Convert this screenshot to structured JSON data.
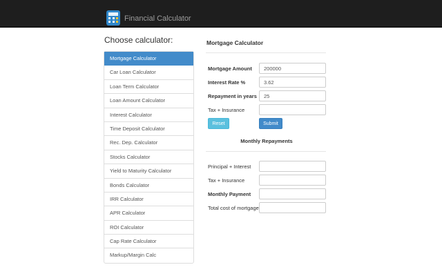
{
  "header": {
    "app_title": "Financial Calculator",
    "icon": "calculator-icon"
  },
  "sidebar": {
    "title": "Choose calculator:",
    "items": [
      {
        "label": "Mortgage Calculator",
        "active": true
      },
      {
        "label": "Car Loan Calculator"
      },
      {
        "label": "Loan Term Calculator"
      },
      {
        "label": "Loan Amount Calculator"
      },
      {
        "label": "Interest Calculator"
      },
      {
        "label": "Time Deposit Calculator"
      },
      {
        "label": "Rec. Dep. Calculator"
      },
      {
        "label": "Stocks Calculator"
      },
      {
        "label": "Yield to Maturity Calculator"
      },
      {
        "label": "Bonds Calculator"
      },
      {
        "label": "IRR Calculator"
      },
      {
        "label": "APR Calculator"
      },
      {
        "label": "ROI Calculator"
      },
      {
        "label": "Cap Rate Calculator"
      },
      {
        "label": "Markup/Margin Calc"
      }
    ]
  },
  "form": {
    "title": "Mortgage Calculator",
    "mortgage_amount": {
      "label": "Mortgage Amount",
      "value": "200000"
    },
    "interest_rate": {
      "label": "Interest Rate %",
      "value": "3.62"
    },
    "repayment_years": {
      "label": "Repayment in years",
      "value": "25"
    },
    "tax_insurance": {
      "label": "Tax + Insurance",
      "value": ""
    },
    "reset_label": "Reset",
    "submit_label": "Submit"
  },
  "results": {
    "title": "Monthly Repayments",
    "principal_interest": {
      "label": "Principal + Interest",
      "value": ""
    },
    "tax_insurance": {
      "label": "Tax + Insurance",
      "value": ""
    },
    "monthly_payment": {
      "label": "Monthly Payment",
      "value": ""
    },
    "total_cost": {
      "label": "Total cost of mortgage",
      "value": ""
    }
  },
  "colors": {
    "header_bg": "#1e1e1e",
    "active_item": "#428bca",
    "reset_button": "#5bc0de",
    "submit_button": "#428bca"
  }
}
